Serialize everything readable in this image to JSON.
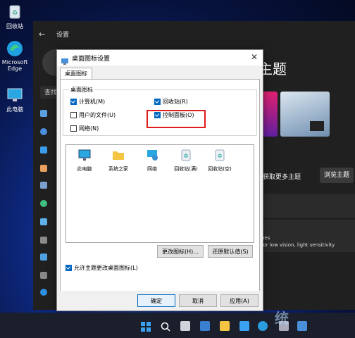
{
  "desktop": {
    "icons": [
      {
        "label": "回收站",
        "icon": "recycle-bin-icon"
      },
      {
        "label": "Microsoft Edge",
        "icon": "edge-icon"
      },
      {
        "label": "此电脑",
        "icon": "computer-icon"
      }
    ]
  },
  "settings": {
    "title": "设置",
    "search_placeholder": "查找",
    "page_heading": "主题",
    "get_more_label": "获取更多主题",
    "browse_button": "浏览主题",
    "row_text_1": "nes",
    "row_text_2": "for low vision, light sensitivity"
  },
  "dialog": {
    "title": "桌面图标设置",
    "tab": "桌面图标",
    "group_label": "桌面图标",
    "checkboxes": [
      {
        "label": "计算机(M)",
        "checked": true
      },
      {
        "label": "回收站(R)",
        "checked": true
      },
      {
        "label": "用户的文件(U)",
        "checked": false
      },
      {
        "label": "控制面板(O)",
        "checked": true
      },
      {
        "label": "网络(N)",
        "checked": false
      }
    ],
    "icons": [
      {
        "label": "此电脑",
        "icon": "computer-icon"
      },
      {
        "label": "系统之家",
        "icon": "folder-icon"
      },
      {
        "label": "网络",
        "icon": "network-icon"
      },
      {
        "label": "回收站(满)",
        "icon": "recycle-bin-full-icon"
      },
      {
        "label": "回收站(空)",
        "icon": "recycle-bin-empty-icon"
      }
    ],
    "change_icon_button": "更改图标(H)...",
    "restore_default_button": "还原默认值(S)",
    "allow_themes_label": "允许主题更改桌面图标(L)",
    "allow_themes_checked": true,
    "ok_button": "确定",
    "cancel_button": "取消",
    "apply_button": "应用(A)"
  },
  "watermark": "统",
  "colors": {
    "accent": "#0067c0",
    "highlight_box": "#e21c1c"
  }
}
